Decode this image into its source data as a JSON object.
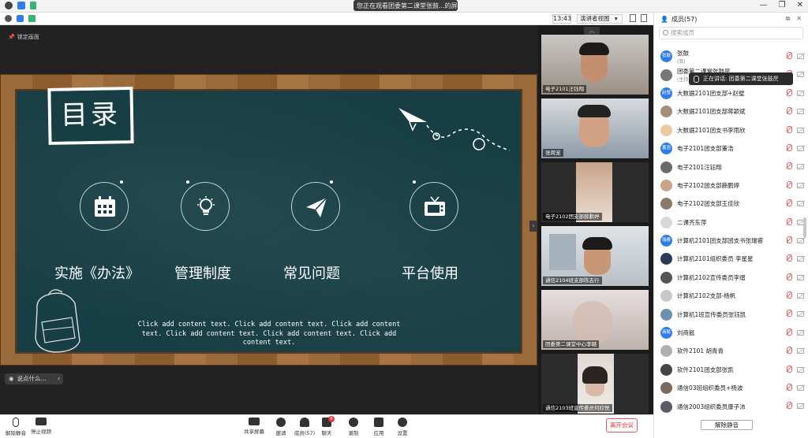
{
  "title_bar": {
    "sharing_text": "您正在观看团委第二课堂张鼓...的屏幕"
  },
  "sub_bar": {
    "time": "13:43",
    "view_mode": "演讲者视图"
  },
  "stage": {
    "lock_label": "锁定画面",
    "chat_hint": "说点什么...",
    "slide": {
      "title": "目录",
      "items": [
        {
          "label": "实施《办法》",
          "icon": "calendar-icon"
        },
        {
          "label": "管理制度",
          "icon": "lightbulb-icon"
        },
        {
          "label": "常见问题",
          "icon": "paper-plane-icon"
        },
        {
          "label": "平台使用",
          "icon": "tv-icon"
        }
      ],
      "body_text": "Click add content text. Click add content text. Click add content text. Click add content text. Click add content text. Click add content text."
    }
  },
  "videos": [
    {
      "name": "电子2101汪钰翔"
    },
    {
      "name": "张周宠"
    },
    {
      "name": "电子2102团支部薛鹏婷"
    },
    {
      "name": "通信2104班支部陈志行"
    },
    {
      "name": "团委第二课堂中心李璐"
    },
    {
      "name": "通信2103班宣传委员何欣悦"
    }
  ],
  "members_panel": {
    "title": "成员(57)",
    "search_placeholder": "搜索成员",
    "speaking_text": "正在讲话: 团委第二课堂张鼓昃",
    "unmute_all": "解除静音",
    "members": [
      {
        "name": "张鼓",
        "sub": "(我)",
        "avatar_text": "张鼓",
        "color": "#2f7ee8"
      },
      {
        "name": "团委第二课堂张鼓昃",
        "sub": "(主持人)",
        "avatar_text": "",
        "color": "#777777"
      },
      {
        "name": "大数据2101团支部+赵璧",
        "sub": "",
        "avatar_text": "赵璧",
        "color": "#2f7ee8"
      },
      {
        "name": "大数据2101团支部蒋颖斌",
        "sub": "",
        "avatar_text": "",
        "color": "#a58d74"
      },
      {
        "name": "大数据2101团支书李雨欣",
        "sub": "",
        "avatar_text": "",
        "color": "#e8c9a0"
      },
      {
        "name": "电子2101团支部董浩",
        "sub": "",
        "avatar_text": "董浩",
        "color": "#2f7ee8"
      },
      {
        "name": "电子2101汪钰翔",
        "sub": "",
        "avatar_text": "",
        "color": "#6a6a6a"
      },
      {
        "name": "电子2102团支部薛鹏婷",
        "sub": "",
        "avatar_text": "",
        "color": "#c9a48a"
      },
      {
        "name": "电子2102团支部王佳欣",
        "sub": "",
        "avatar_text": "",
        "color": "#8a7a6a"
      },
      {
        "name": "二课齐东萍",
        "sub": "",
        "avatar_text": "",
        "color": "#d8d8d8"
      },
      {
        "name": "计算机2101团支部团支书张瑞睿",
        "sub": "",
        "avatar_text": "瑞睿",
        "color": "#2f7ee8"
      },
      {
        "name": "计算机2101组织委员 李星星",
        "sub": "",
        "avatar_text": "",
        "color": "#2a3b55"
      },
      {
        "name": "计算机2102宣传委员李熠",
        "sub": "",
        "avatar_text": "",
        "color": "#555555"
      },
      {
        "name": "计算机2102支部-杨帆",
        "sub": "",
        "avatar_text": "",
        "color": "#c8c8c8"
      },
      {
        "name": "计算机1班宣传委员张钰凯",
        "sub": "",
        "avatar_text": "",
        "color": "#6d8fb0"
      },
      {
        "name": "刘商懿",
        "sub": "",
        "avatar_text": "商懿",
        "color": "#2f7ee8"
      },
      {
        "name": "软件2101 胡青青",
        "sub": "",
        "avatar_text": "",
        "color": "#b0b0b0"
      },
      {
        "name": "软件2101团支部张凯",
        "sub": "",
        "avatar_text": "",
        "color": "#444444"
      },
      {
        "name": "通信03班组织委员+杨波",
        "sub": "",
        "avatar_text": "",
        "color": "#7a6a5a"
      },
      {
        "name": "通信2003组织委员康子沛",
        "sub": "",
        "avatar_text": "",
        "color": "#5a5a6a"
      }
    ]
  },
  "toolbar": {
    "mute": "解除静音",
    "video": "停止视频",
    "share": "共享屏幕",
    "invite": "邀请",
    "members": "成员(57)",
    "chat": "聊天",
    "chat_badge": "8",
    "record": "录制",
    "apps": "应用",
    "settings": "设置",
    "leave": "离开会议"
  }
}
